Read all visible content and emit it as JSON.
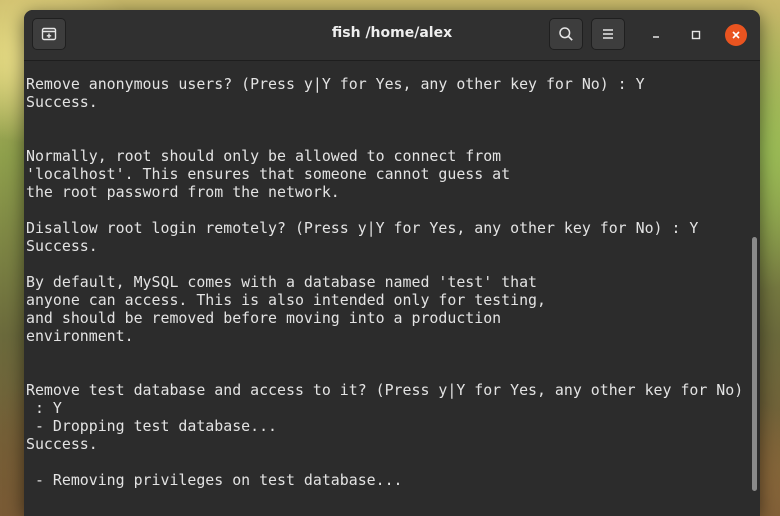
{
  "window": {
    "title": "fish /home/alex",
    "buttons": {
      "new_tab_icon": "new-tab-icon",
      "search_icon": "search-icon",
      "menu_icon": "hamburger-menu-icon",
      "minimize_icon": "minimize-icon",
      "maximize_icon": "maximize-icon",
      "close_icon": "close-icon"
    },
    "colors": {
      "close_button": "#e95420",
      "terminal_background": "#2c2c2c",
      "text": "#e3e3e3"
    }
  },
  "terminal": {
    "lines": [
      "Remove anonymous users? (Press y|Y for Yes, any other key for No) : Y",
      "Success.",
      "",
      "",
      "Normally, root should only be allowed to connect from",
      "'localhost'. This ensures that someone cannot guess at",
      "the root password from the network.",
      "",
      "Disallow root login remotely? (Press y|Y for Yes, any other key for No) : Y",
      "Success.",
      "",
      "By default, MySQL comes with a database named 'test' that",
      "anyone can access. This is also intended only for testing,",
      "and should be removed before moving into a production",
      "environment.",
      "",
      "",
      "Remove test database and access to it? (Press y|Y for Yes, any other key for No)",
      " : Y",
      " - Dropping test database...",
      "Success.",
      "",
      " - Removing privileges on test database..."
    ]
  }
}
